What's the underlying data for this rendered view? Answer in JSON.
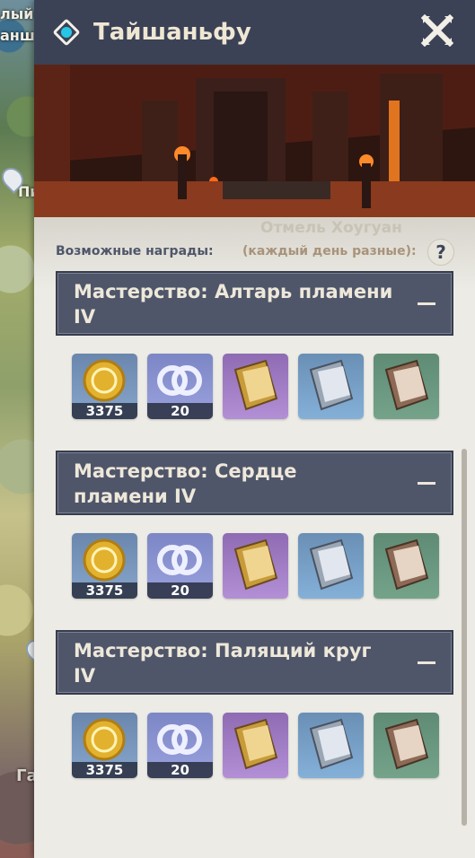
{
  "map": {
    "labels": [
      "лый",
      "анш",
      "Пип",
      "Гавань Ли Юэ"
    ]
  },
  "header": {
    "title": "Тайшаньфу"
  },
  "content": {
    "faded_label": "Отмель Хоугуан",
    "rewards_label": "Возможные награды:",
    "rewards_note": "(каждый день разные):",
    "help": "?"
  },
  "sections": [
    {
      "title": "Мастерство: Алтарь пламени IV",
      "items": [
        {
          "icon": "mora-coin-icon",
          "count": "3375"
        },
        {
          "icon": "companionship-exp-icon",
          "count": "20"
        },
        {
          "icon": "talent-book-purple-icon",
          "count": ""
        },
        {
          "icon": "talent-book-blue-icon",
          "count": ""
        },
        {
          "icon": "talent-book-green-icon",
          "count": ""
        }
      ]
    },
    {
      "title": "Мастерство: Сердце пламени IV",
      "items": [
        {
          "icon": "mora-coin-icon",
          "count": "3375"
        },
        {
          "icon": "companionship-exp-icon",
          "count": "20"
        },
        {
          "icon": "talent-book-purple-icon",
          "count": ""
        },
        {
          "icon": "talent-book-blue-icon",
          "count": ""
        },
        {
          "icon": "talent-book-green-icon",
          "count": ""
        }
      ]
    },
    {
      "title": "Мастерство: Палящий круг IV",
      "items": [
        {
          "icon": "mora-coin-icon",
          "count": "3375"
        },
        {
          "icon": "companionship-exp-icon",
          "count": "20"
        },
        {
          "icon": "talent-book-purple-icon",
          "count": ""
        },
        {
          "icon": "talent-book-blue-icon",
          "count": ""
        },
        {
          "icon": "talent-book-green-icon",
          "count": ""
        }
      ]
    }
  ]
}
